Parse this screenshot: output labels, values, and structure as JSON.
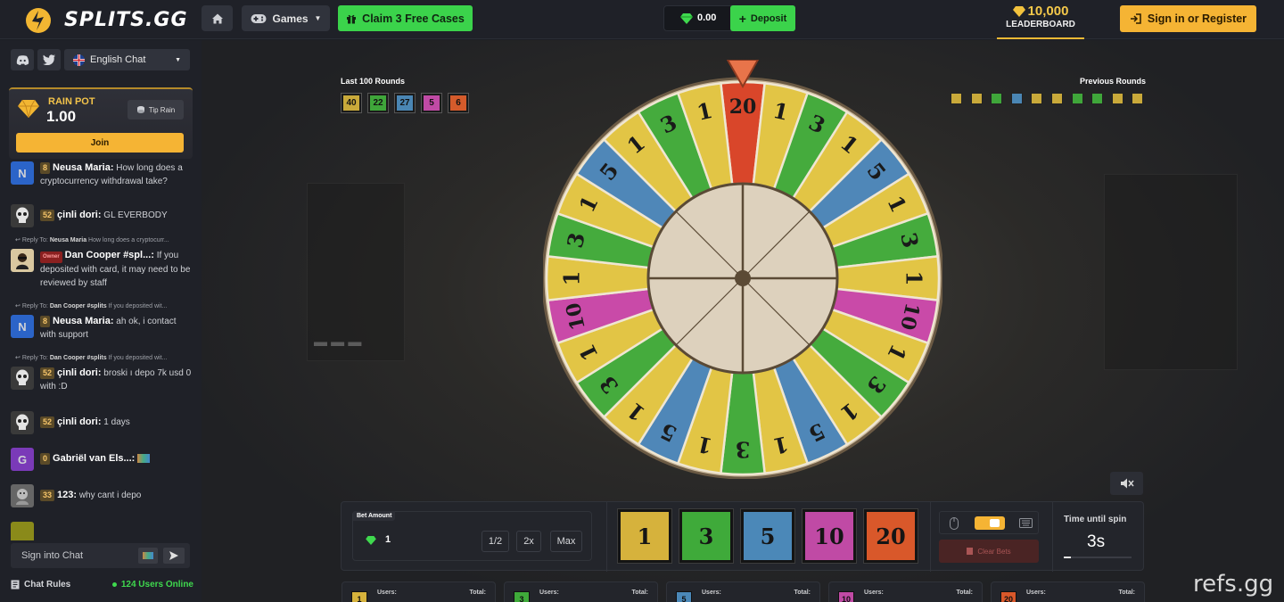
{
  "header": {
    "logo_text": "SPLITS.GG",
    "games_label": "Games",
    "claim_label": "Claim 3 Free Cases",
    "balance": "0.00",
    "deposit_label": "Deposit",
    "leaderboard_amount": "10,000",
    "leaderboard_label": "LEADERBOARD",
    "signin_label": "Sign in or Register"
  },
  "sidebar": {
    "language": "English Chat",
    "rain": {
      "title": "RAIN POT",
      "amount": "1.00",
      "tip_label": "Tip Rain",
      "join_label": "Join"
    },
    "messages": [
      {
        "avatar": "N",
        "level": "8",
        "name": "Neusa Maria:",
        "text": "How long does a cryptocurrency withdrawal take?"
      },
      {
        "avatar": "skull",
        "level": "52",
        "name": "çinli dori:",
        "text": "GL EVERBODY"
      },
      {
        "reply_name": "Neusa Maria",
        "reply_text": "How long does a cryptocurr...",
        "reply_prefix": "Reply To:"
      },
      {
        "avatar": "dan",
        "badge": "Owner",
        "name": "Dan Cooper #spl...:",
        "text": "If you deposited with card, it may need to be reviewed by staff"
      },
      {
        "reply_name": "Dan Cooper #splits",
        "reply_text": "If you deposited wit...",
        "reply_prefix": "Reply To:"
      },
      {
        "avatar": "N",
        "level": "8",
        "name": "Neusa Maria:",
        "text": "ah ok, i contact with support"
      },
      {
        "reply_name": "Dan Cooper #splits",
        "reply_text": "If you deposited wit...",
        "reply_prefix": "Reply To:"
      },
      {
        "avatar": "skull",
        "level": "52",
        "name": "çinli dori:",
        "text": "broski ı depo 7k usd 0 with :D"
      },
      {
        "avatar": "skull",
        "level": "52",
        "name": "çinli dori:",
        "text": "1 days"
      },
      {
        "avatar": "G",
        "level": "0",
        "name": "Gabriël van Els...:",
        "text": ""
      },
      {
        "avatar": "face",
        "level": "33",
        "name": "123:",
        "text": "why cant i depo"
      }
    ],
    "chat_placeholder": "Sign into Chat",
    "rules_label": "Chat Rules",
    "online_label": "124 Users Online"
  },
  "game": {
    "last100_label": "Last 100 Rounds",
    "last100": [
      {
        "value": "40",
        "color": "#c9a93a"
      },
      {
        "value": "22",
        "color": "#3fa63a"
      },
      {
        "value": "27",
        "color": "#4a86b4"
      },
      {
        "value": "5",
        "color": "#c04aa5"
      },
      {
        "value": "6",
        "color": "#d45b2b"
      }
    ],
    "previous_label": "Previous Rounds",
    "previous_colors": [
      "#c9a93a",
      "#c9a93a",
      "#3fa63a",
      "#4a86b4",
      "#c9a93a",
      "#c9a93a",
      "#3fa63a",
      "#3fa63a",
      "#c9a93a",
      "#c9a93a"
    ],
    "wheel_segments": [
      "20",
      "1",
      "3",
      "1",
      "5",
      "1",
      "3",
      "1",
      "10",
      "1",
      "3",
      "1",
      "5",
      "1",
      "3",
      "1",
      "5",
      "1",
      "3",
      "1",
      "10",
      "1",
      "3",
      "1",
      "5",
      "1",
      "3",
      "1"
    ],
    "bet_label": "Bet Amount",
    "bet_value": "1",
    "half_label": "1/2",
    "double_label": "2x",
    "max_label": "Max",
    "tiles": [
      {
        "value": "1",
        "color": "#d6b23c"
      },
      {
        "value": "3",
        "color": "#3faa3a"
      },
      {
        "value": "5",
        "color": "#4b88b8"
      },
      {
        "value": "10",
        "color": "#c04aa5"
      },
      {
        "value": "20",
        "color": "#d9582a"
      }
    ],
    "clear_label": "Clear Bets",
    "timer_label": "Time until spin",
    "timer_value": "3s",
    "timer_progress": 0.1,
    "cards": [
      {
        "num": "1",
        "color": "#d6b23c",
        "users": "Users:",
        "total": "Total:"
      },
      {
        "num": "3",
        "color": "#3faa3a",
        "users": "Users:",
        "total": "Total:"
      },
      {
        "num": "5",
        "color": "#4b88b8",
        "users": "Users:",
        "total": "Total:"
      },
      {
        "num": "10",
        "color": "#c04aa5",
        "users": "Users:",
        "total": "Total:"
      },
      {
        "num": "20",
        "color": "#d9582a",
        "users": "Users:",
        "total": "Total:"
      }
    ]
  },
  "watermark": "refs.gg",
  "segment_colors": {
    "1": "#e2c545",
    "3": "#45ab3d",
    "5": "#4f87b8",
    "10": "#c94aa8",
    "20": "#d9462a"
  }
}
